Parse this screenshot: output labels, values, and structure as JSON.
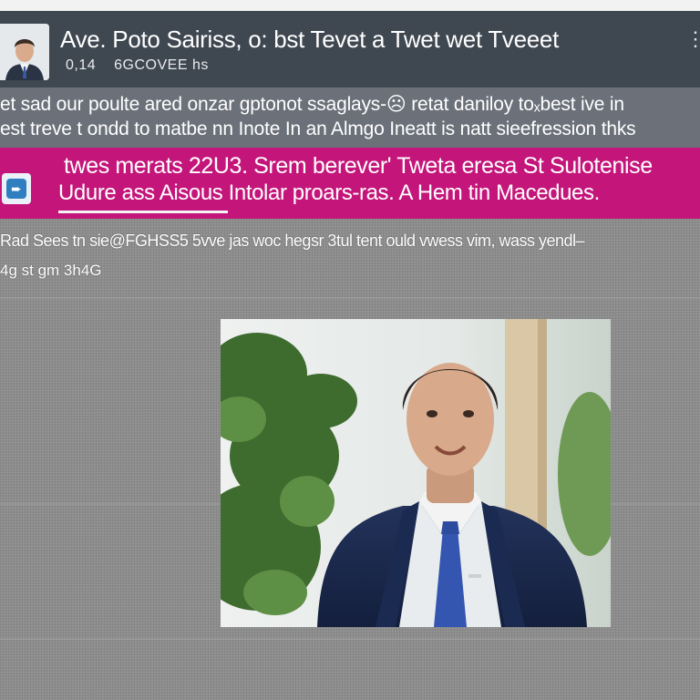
{
  "post": {
    "author_title": "Ave. Poto Sairiss, o: bst Tevet a Twet wet Tveeet",
    "time": "0,14",
    "handle": "6GCOVEE hs",
    "more_icon": "more-icon",
    "body_line1": "et sad our poulte ared onzar gptonot ssaglays-☹ retat daniloy toₓbest ive in",
    "body_line2": "est treve t ondd to matbe nn Inote In an Almgo Ineatt is natt sieefression thks"
  },
  "banner": {
    "line1": "twes merats 22U3. Srem berever' Tweta eresa St Sulotenise",
    "line2": "Udure ass Aisous Intolar proars-ras. A Hem tin Macedues.",
    "icon": "app-icon"
  },
  "caption": {
    "line1": "Rad Sees tn sie@FGHSS5 5vve jas woc hegsr 3tul tent ould vwess vim, wass yendl–",
    "line2": "4g st gm 3h4G"
  },
  "colors": {
    "header_bg": "#3f4750",
    "body_bg": "#6b7079",
    "banner_bg": "#c4157a",
    "content_bg": "#8d8d8d"
  }
}
